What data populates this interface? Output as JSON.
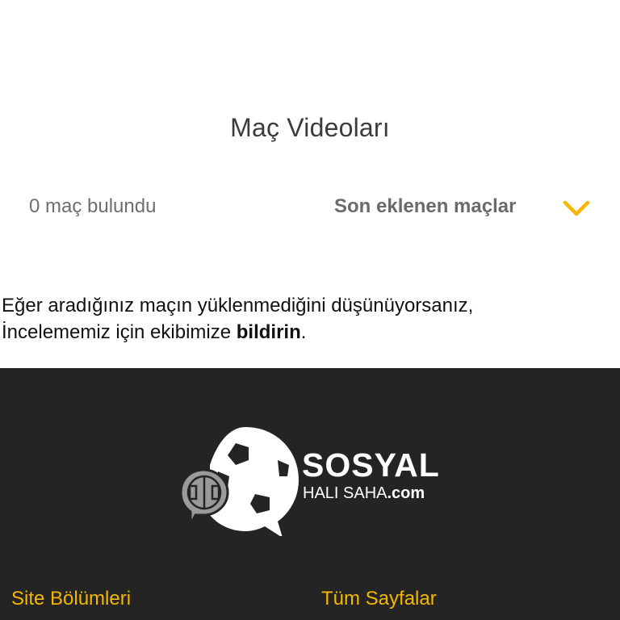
{
  "page": {
    "title": "Maç Videoları"
  },
  "filter": {
    "result_count": "0 maç bulundu",
    "sort_label": "Son eklenen maçlar",
    "icon": "chevron-down-icon"
  },
  "notice": {
    "line1": "Eğer aradığınız maçın yüklenmediğini düşünüyorsanız,",
    "line2_prefix": "İncelememiz için ekibimize ",
    "link_text": "bildirin",
    "line2_suffix": "."
  },
  "footer": {
    "logo": {
      "main": "SOSYAL",
      "sub": "HALI SAHA",
      "suffix": ".com"
    },
    "sections": [
      {
        "label": "Site Bölümleri"
      },
      {
        "label": "Tüm Sayfalar"
      }
    ]
  },
  "colors": {
    "accent": "#f5b700",
    "footer_bg": "#242424"
  }
}
